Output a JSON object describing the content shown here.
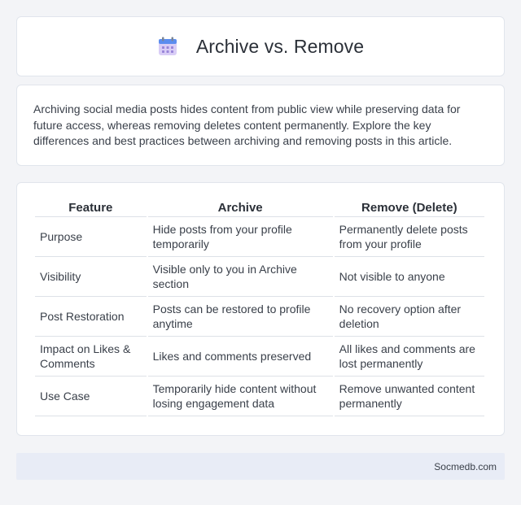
{
  "header": {
    "title": "Archive vs. Remove",
    "icon": "calendar-icon"
  },
  "intro": {
    "text": "Archiving social media posts hides content from public view while preserving data for future access, whereas removing deletes content permanently. Explore the key differences and best practices between archiving and removing posts in this article."
  },
  "table": {
    "headers": [
      "Feature",
      "Archive",
      "Remove (Delete)"
    ],
    "rows": [
      [
        "Purpose",
        "Hide posts from your profile temporarily",
        "Permanently delete posts from your profile"
      ],
      [
        "Visibility",
        "Visible only to you in Archive section",
        "Not visible to anyone"
      ],
      [
        "Post Restoration",
        "Posts can be restored to profile anytime",
        "No recovery option after deletion"
      ],
      [
        "Impact on Likes & Comments",
        "Likes and comments preserved",
        "All likes and comments are lost permanently"
      ],
      [
        "Use Case",
        "Temporarily hide content without losing engagement data",
        "Remove unwanted content permanently"
      ]
    ]
  },
  "footer": {
    "site": "Socmedb.com"
  },
  "colors": {
    "background": "#f3f4f7",
    "footer_bg": "#e8ecf6",
    "icon_top": "#5b8def",
    "icon_body": "#c9b8f0"
  }
}
